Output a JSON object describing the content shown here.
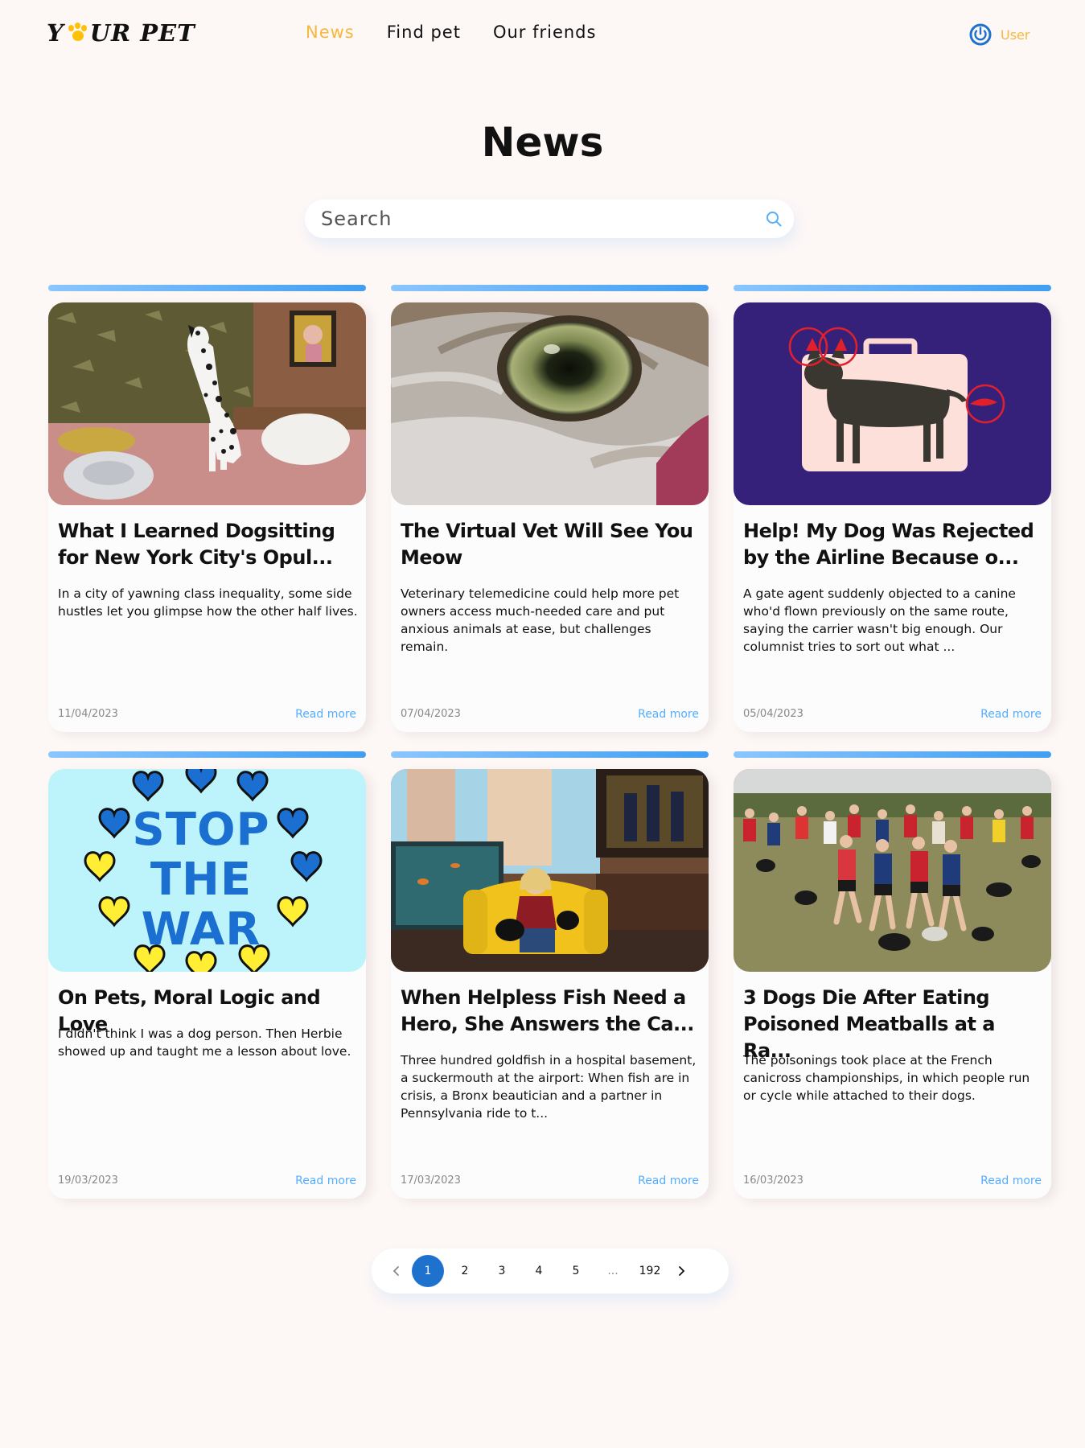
{
  "header": {
    "logo_text_left": "Y",
    "logo_text_right": "UR PET",
    "nav": [
      {
        "label": "News",
        "active": true
      },
      {
        "label": "Find pet",
        "active": false
      },
      {
        "label": "Our friends",
        "active": false
      }
    ],
    "user_label": "User",
    "user_icon": "user-power-icon",
    "accent_color": "#F6B83D"
  },
  "main": {
    "title": "News",
    "search": {
      "placeholder": "Search",
      "value": "",
      "icon": "search-icon"
    }
  },
  "cards": [
    {
      "image": "dalmatian-on-bed",
      "title": "What I Learned Dogsitting for New York City's Opul...",
      "text": "In a city of yawning class inequality, some side hustles let you glimpse how the other half lives.",
      "date": "11/04/2023",
      "more": "Read more"
    },
    {
      "image": "cat-eye-closeup",
      "title": "The Virtual Vet Will See You Meow",
      "text": "Veterinary telemedicine could help more pet owners access much-needed care and put anxious animals at ease, but challenges remain.",
      "date": "07/04/2023",
      "more": "Read more"
    },
    {
      "image": "dog-airline-illustration",
      "title": "Help! My Dog Was Rejected by the Airline Because o...",
      "text": "A gate agent suddenly objected to a canine who'd flown previously on the same route, saying the carrier wasn't big enough. Our columnist tries to sort out what ...",
      "date": "05/04/2023",
      "more": "Read more"
    },
    {
      "image": "stop-the-war-poster",
      "title": "On Pets, Moral Logic and Love",
      "text": "I didn't think I was a dog person. Then Herbie showed up and taught me a lesson about love.",
      "date": "19/03/2023",
      "more": "Read more",
      "poster_words": [
        "STOP",
        "THE",
        "WAR"
      ]
    },
    {
      "image": "woman-on-yellow-couch",
      "title": "When Helpless Fish Need a Hero, She Answers the Ca...",
      "text": "Three hundred goldfish in a hospital basement, a suckermouth at the airport: When fish are in crisis, a Bronx beautician and a partner in Pennsylvania ride to t...",
      "date": "17/03/2023",
      "more": "Read more"
    },
    {
      "image": "canicross-runners",
      "title": "3 Dogs Die After Eating Poisoned Meatballs at a Ra...",
      "text": "The poisonings took place at the French canicross championships, in which people run or cycle while attached to their dogs.",
      "date": "16/03/2023",
      "more": "Read more"
    }
  ],
  "pagination": {
    "prev_icon": "chevron-left-icon",
    "next_icon": "chevron-right-icon",
    "pages": [
      "1",
      "2",
      "3",
      "4",
      "5",
      "...",
      "192"
    ],
    "current": "1",
    "current_color": "#1E72CE"
  }
}
